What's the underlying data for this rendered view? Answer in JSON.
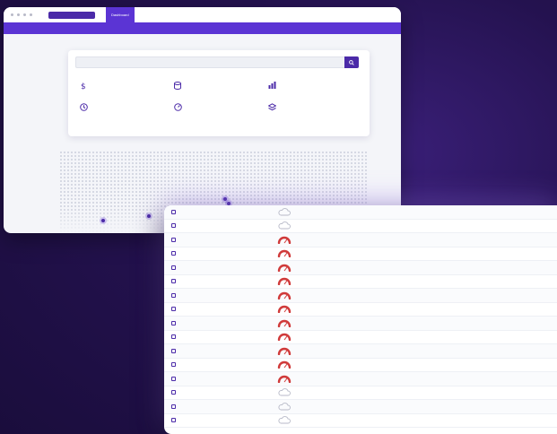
{
  "dashboard": {
    "brand": "",
    "nav": [
      "Dashboard",
      "",
      "",
      "",
      "",
      ""
    ],
    "active_nav": 0,
    "subnav": [
      "",
      "",
      "",
      ""
    ],
    "search_placeholder": "",
    "stats": [
      {
        "label": "",
        "value": "",
        "icon": "dollar-icon"
      },
      {
        "label": "",
        "value": "",
        "icon": "database-icon"
      },
      {
        "label": "",
        "value": "",
        "icon": "chart-icon"
      },
      {
        "label": "",
        "value": "",
        "icon": "clock-icon"
      },
      {
        "label": "",
        "value": "",
        "icon": "gauge-icon"
      },
      {
        "label": "",
        "value": "",
        "icon": "layers-icon"
      }
    ]
  },
  "table": {
    "rows": [
      {
        "block": "",
        "age": "",
        "gauge": "cloud",
        "gas": "",
        "miner": "",
        "miner_sup": "",
        "txns": "",
        "reward": "",
        "reward_sup": ""
      },
      {
        "block": "",
        "age": "",
        "gauge": "cloud",
        "gas": "",
        "miner": "",
        "miner_sup": "",
        "txns": "",
        "reward": "",
        "reward_sup": ""
      },
      {
        "block": "",
        "age": "",
        "gauge": "red",
        "gas": "",
        "miner": "",
        "miner_sup": "",
        "txns": "",
        "reward": "",
        "reward_sup": ""
      },
      {
        "block": "",
        "age": "",
        "gauge": "red",
        "gas": "",
        "miner": "",
        "miner_sup": "",
        "txns": "",
        "reward": "",
        "reward_sup": ""
      },
      {
        "block": "",
        "age": "",
        "gauge": "red",
        "gas": "",
        "miner": "",
        "miner_sup": "",
        "txns": "",
        "reward": "",
        "reward_sup": ""
      },
      {
        "block": "",
        "age": "",
        "gauge": "red",
        "gas": "",
        "miner": "",
        "miner_sup": "",
        "txns": "",
        "reward": "",
        "reward_sup": ""
      },
      {
        "block": "",
        "age": "",
        "gauge": "red",
        "gas": "",
        "miner": "",
        "miner_sup": "",
        "txns": "",
        "reward": "",
        "reward_sup": ""
      },
      {
        "block": "",
        "age": "",
        "gauge": "red",
        "gas": "",
        "miner": "",
        "miner_sup": "",
        "txns": "",
        "reward": "",
        "reward_sup": ""
      },
      {
        "block": "",
        "age": "",
        "gauge": "red",
        "gas": "",
        "miner": "",
        "miner_sup": "",
        "txns": "",
        "reward": "",
        "reward_sup": ""
      },
      {
        "block": "",
        "age": "",
        "gauge": "red",
        "gas": "",
        "miner": "",
        "miner_sup": "",
        "txns": "",
        "reward": "",
        "reward_sup": ""
      },
      {
        "block": "",
        "age": "",
        "gauge": "red",
        "gas": "",
        "miner": "",
        "miner_sup": "",
        "txns": "",
        "reward": "",
        "reward_sup": ""
      },
      {
        "block": "",
        "age": "",
        "gauge": "red",
        "gas": "",
        "miner": "",
        "miner_sup": "",
        "txns": "",
        "reward": "",
        "reward_sup": ""
      },
      {
        "block": "",
        "age": "",
        "gauge": "red",
        "gas": "",
        "miner": "",
        "miner_sup": "",
        "txns": "",
        "reward": "",
        "reward_sup": ""
      },
      {
        "block": "",
        "age": "",
        "gauge": "cloud",
        "gas": "",
        "miner": "",
        "miner_sup": "",
        "txns": "",
        "reward": "",
        "reward_sup": ""
      },
      {
        "block": "",
        "age": "",
        "gauge": "cloud",
        "gas": "",
        "miner": "",
        "miner_sup": "",
        "txns": "",
        "reward": "",
        "reward_sup": ""
      },
      {
        "block": "",
        "age": "",
        "gauge": "cloud",
        "gas": "",
        "miner": "",
        "miner_sup": "",
        "txns": "",
        "reward": "",
        "reward_sup": ""
      }
    ]
  },
  "colors": {
    "accent": "#5b34d4",
    "accent_dark": "#4b2aa8",
    "gauge_red": "#d03a3a",
    "gauge_grey": "#b8bac8",
    "bg_dark": "#24124f"
  }
}
